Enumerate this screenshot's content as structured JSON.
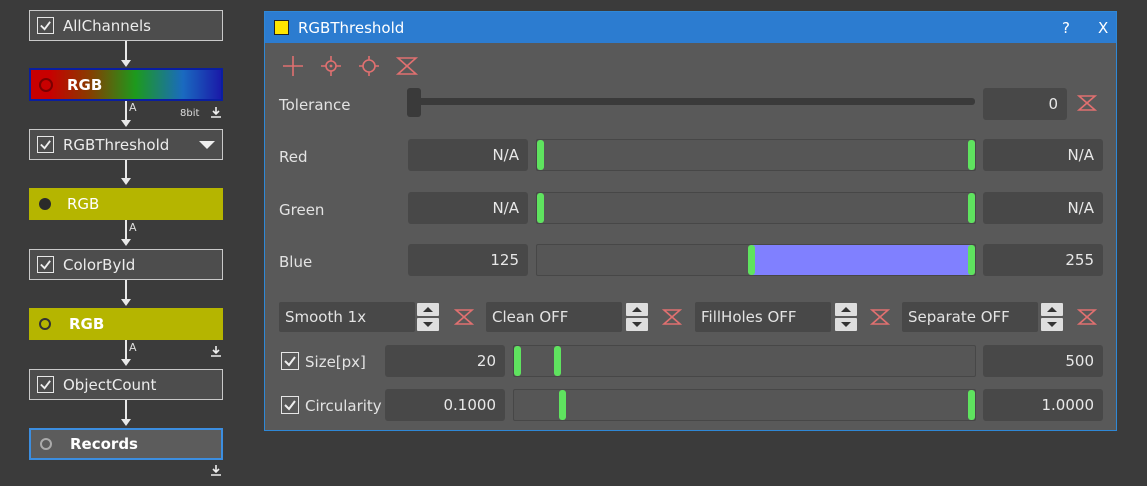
{
  "pipeline": {
    "nodes": [
      {
        "label": "AllChannels"
      },
      {
        "label": "RGB"
      },
      {
        "label": "RGBThreshold"
      },
      {
        "label": "RGB"
      },
      {
        "label": "ColorById"
      },
      {
        "label": "RGB"
      },
      {
        "label": "ObjectCount"
      },
      {
        "label": "Records"
      }
    ],
    "port_label": "A",
    "bit_depth": "8bit"
  },
  "dialog": {
    "title": "RGBThreshold",
    "help_label": "?",
    "close_label": "X",
    "tools": [
      "crosshair-add-icon",
      "crosshair-point-icon",
      "crosshair-target-icon",
      "reset-icon"
    ],
    "tolerance": {
      "label": "Tolerance",
      "value": "0",
      "level": 0
    },
    "red": {
      "label": "Red",
      "min": "N/A",
      "max": "N/A",
      "range": [
        0,
        255
      ]
    },
    "green": {
      "label": "Green",
      "min": "N/A",
      "max": "N/A",
      "range": [
        0,
        255
      ]
    },
    "blue": {
      "label": "Blue",
      "min": "125",
      "max": "255",
      "range": [
        125,
        255
      ]
    },
    "options": [
      {
        "label": "Smooth 1x"
      },
      {
        "label": "Clean OFF"
      },
      {
        "label": "FillHoles OFF"
      },
      {
        "label": "Separate OFF"
      }
    ],
    "size": {
      "label": "Size[px]",
      "checked": true,
      "min": "20",
      "max": "500"
    },
    "circularity": {
      "label": "Circularity",
      "checked": true,
      "min": "0.1000",
      "max": "1.0000"
    }
  },
  "colors": {
    "accent": "#2c7cd0",
    "handle": "#5fe35f",
    "blue_range": "#8080ff",
    "node_yellow": "#b5b500",
    "reset_icon": "#e07070"
  }
}
